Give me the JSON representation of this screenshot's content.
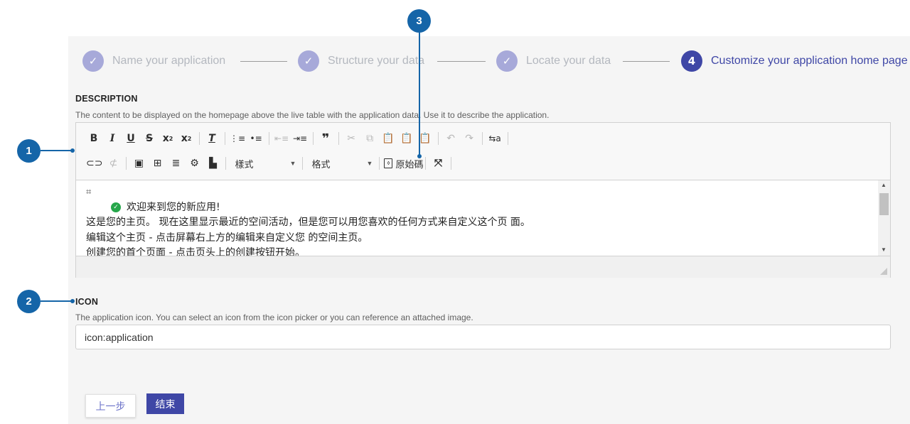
{
  "wizard": {
    "steps": [
      {
        "number": "✓",
        "label": "Name your application",
        "state": "done"
      },
      {
        "number": "✓",
        "label": "Structure your data",
        "state": "done"
      },
      {
        "number": "✓",
        "label": "Locate your data",
        "state": "done"
      },
      {
        "number": "4",
        "label": "Customize your application home page",
        "state": "active"
      }
    ]
  },
  "description": {
    "title": "DESCRIPTION",
    "hint": "The content to be displayed on the homepage above the live table with the application data. Use it to describe the application.",
    "toolbar": {
      "style_combo": "樣式",
      "format_combo": "格式",
      "source_label": "原始碼"
    },
    "content": {
      "welcome": "欢迎来到您的新应用!",
      "lines": [
        "这是您的主页。 现在这里显示最近的空间活动，但是您可以用您喜欢的任何方式来自定义这个页 面。",
        "编辑这个主页 - 点击屏幕右上方的编辑来自定义您 的空间主页。",
        "创建您的首个页面 - 点击页头上的创建按钮开始。"
      ]
    }
  },
  "icon": {
    "title": "ICON",
    "hint": "The application icon. You can select an icon from the icon picker or you can reference an attached image.",
    "value": "icon:application"
  },
  "buttons": {
    "prev": "上一步",
    "finish": "结束"
  },
  "callouts": [
    "1",
    "2",
    "3"
  ],
  "colors": {
    "accent": "#3f47a6",
    "step_done": "#a7a9d9",
    "callout": "#1565a8",
    "success": "#26a64a"
  }
}
